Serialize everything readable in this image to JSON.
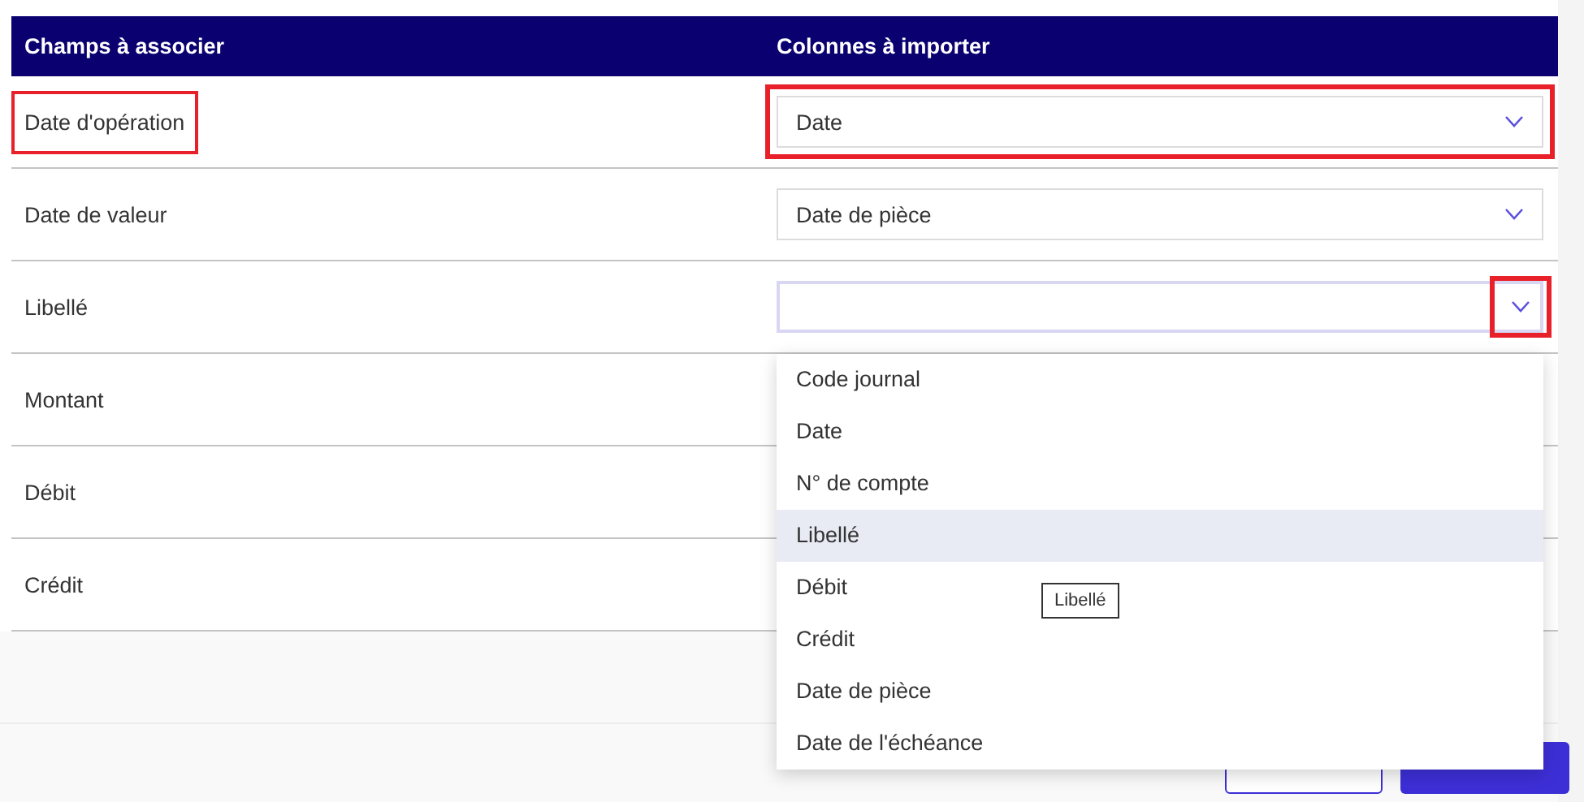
{
  "table": {
    "columns": [
      "Champs à associer",
      "Colonnes à importer"
    ],
    "rows": [
      {
        "field": "Date d'opération",
        "field_highlighted": true,
        "select_highlighted": true,
        "chevron_highlighted": false,
        "value": "Date",
        "open": false
      },
      {
        "field": "Date de valeur",
        "field_highlighted": false,
        "select_highlighted": false,
        "chevron_highlighted": false,
        "value": "Date de pièce",
        "open": false
      },
      {
        "field": "Libellé",
        "field_highlighted": false,
        "select_highlighted": false,
        "chevron_highlighted": true,
        "open": true
      },
      {
        "field": "Montant",
        "field_highlighted": false
      },
      {
        "field": "Débit",
        "field_highlighted": false
      },
      {
        "field": "Crédit",
        "field_highlighted": false
      }
    ]
  },
  "dropdown": {
    "options": [
      {
        "label": "Code journal",
        "selected": false
      },
      {
        "label": "Date",
        "selected": false
      },
      {
        "label": "N° de compte",
        "selected": false
      },
      {
        "label": "Libellé",
        "selected": true
      },
      {
        "label": "Débit",
        "selected": false
      },
      {
        "label": "Crédit",
        "selected": false
      },
      {
        "label": "Date de pièce",
        "selected": false
      },
      {
        "label": "Date de l'échéance",
        "selected": false
      }
    ],
    "tooltip": "Libellé"
  },
  "footer": {
    "buttons": [
      {
        "kind": "secondary"
      },
      {
        "kind": "primary"
      }
    ]
  }
}
